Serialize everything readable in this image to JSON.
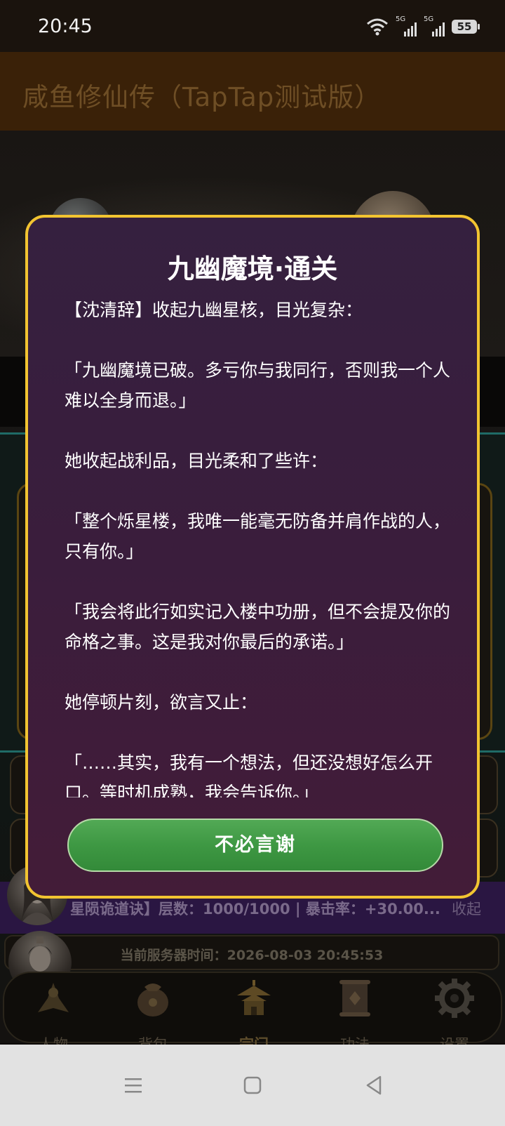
{
  "status_bar": {
    "time": "20:45",
    "network_1": "5G",
    "network_2": "5G",
    "battery": "55"
  },
  "app": {
    "title": "咸鱼修仙传（TapTap测试版）"
  },
  "dialog": {
    "title": "九幽魔境·通关",
    "paragraphs": [
      "【沈清辞】收起九幽星核，目光复杂：",
      "「九幽魔境已破。多亏你与我同行，否则我一个人难以全身而退。」",
      "她收起战利品，目光柔和了些许：",
      "「整个烁星楼，我唯一能毫无防备并肩作战的人，只有你。」",
      "「我会将此行如实记入楼中功册，但不会提及你的命格之事。这是我对你最后的承诺。」",
      "她停顿片刻，欲言又止：",
      "「……其实，我有一个想法，但还没想好怎么开口。等时机成熟，我会告诉你。」"
    ],
    "confirm_label": "不必言谢"
  },
  "buff_bar": {
    "text": "星陨诡道诀】层数：1000/1000 | 暴击率：+30.00...",
    "collapse_label": "收起"
  },
  "server_time": {
    "text": "当前服务器时间：2026-08-03 20:45:53"
  },
  "bottom_nav": {
    "items": [
      {
        "label": "人物",
        "icon": "character-icon"
      },
      {
        "label": "背包",
        "icon": "bag-icon"
      },
      {
        "label": "宗门",
        "icon": "sect-icon"
      },
      {
        "label": "功法",
        "icon": "scroll-icon"
      },
      {
        "label": "设置",
        "icon": "gear-icon"
      }
    ],
    "active_index": 2
  },
  "colors": {
    "dialog_border": "#f2c431",
    "dialog_bg": "#3a1d3c",
    "confirm_button": "#3e9843",
    "header_bg": "#3a2108"
  }
}
